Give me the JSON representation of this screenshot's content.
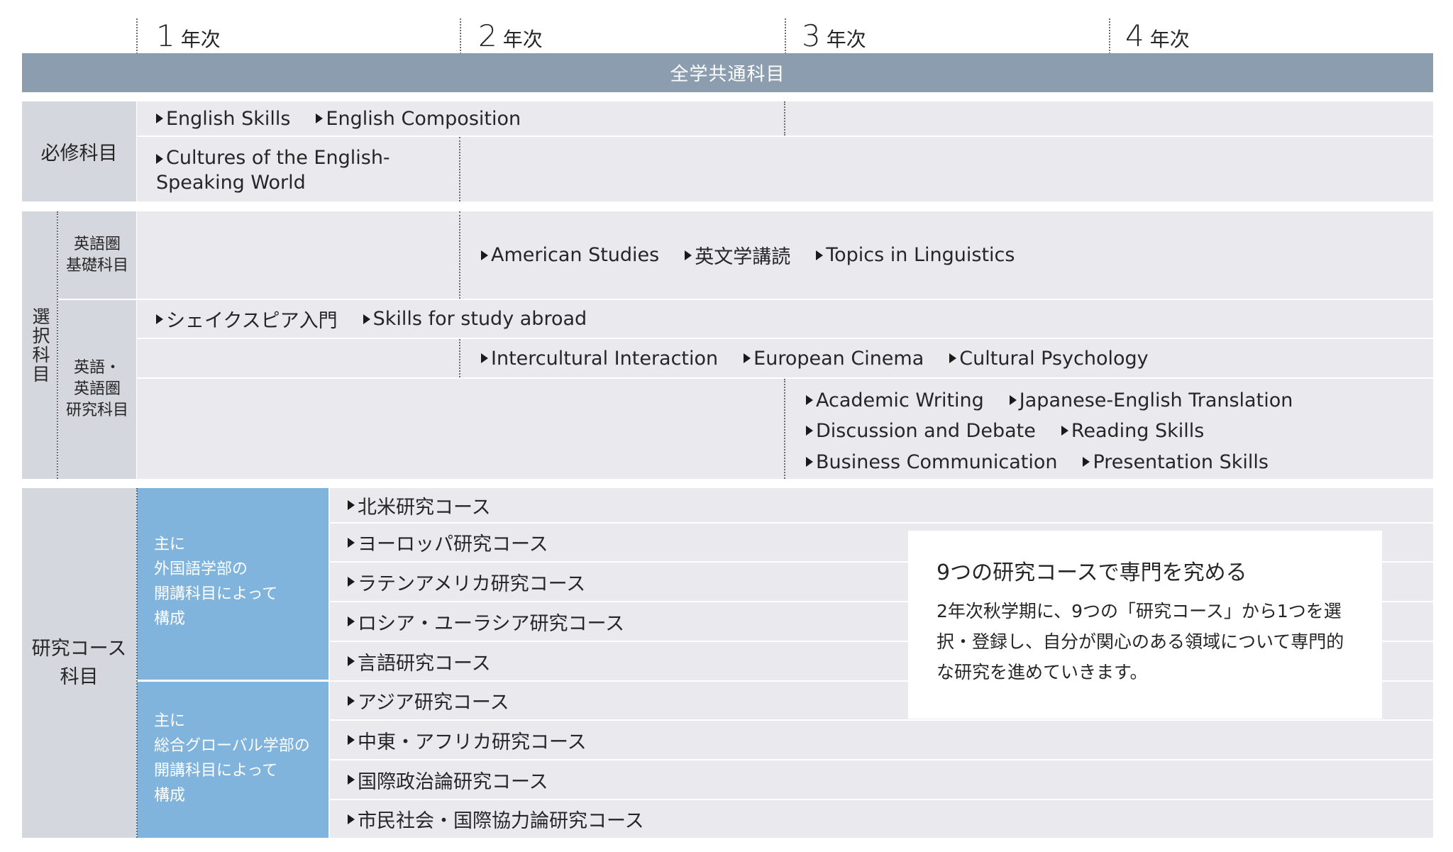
{
  "years": [
    {
      "num": "1",
      "suffix": "年次"
    },
    {
      "num": "2",
      "suffix": "年次"
    },
    {
      "num": "3",
      "suffix": "年次"
    },
    {
      "num": "4",
      "suffix": "年次"
    }
  ],
  "banner": "全学共通科目",
  "required": {
    "label": "必修科目",
    "row1": [
      "English Skills",
      "English Composition"
    ],
    "row2": "Cultures of the English-\nSpeaking World"
  },
  "elective": {
    "label": "選択科目",
    "basic_label": "英語圏\n基礎科目",
    "basic_items": [
      "American Studies",
      "英文学講読",
      "Topics in Linguistics"
    ],
    "research_label": "英語・\n英語圏\n研究科目",
    "row_a": [
      "シェイクスピア入門",
      "Skills for study abroad"
    ],
    "row_b": [
      "Intercultural Interaction",
      "European Cinema",
      "Cultural Psychology"
    ],
    "row_c1": [
      "Academic Writing",
      "Japanese-English Translation"
    ],
    "row_c2": [
      "Discussion and Debate",
      "Reading Skills"
    ],
    "row_c3": [
      "Business Communication",
      "Presentation Skills"
    ]
  },
  "courses": {
    "label": "研究コース\n科目",
    "group1": "主に\n外国語学部の\n開講科目によって\n構成",
    "group2": "主に\n総合グローバル学部の\n開講科目によって\n構成",
    "items": [
      "北米研究コース",
      "ヨーロッパ研究コース",
      "ラテンアメリカ研究コース",
      "ロシア・ユーラシア研究コース",
      "言語研究コース",
      "アジア研究コース",
      "中東・アフリカ研究コース",
      "国際政治論研究コース",
      "市民社会・国際協力論研究コース"
    ]
  },
  "callout": {
    "title": "9つの研究コースで専門を究める",
    "body": "2年次秋学期に、9つの「研究コース」から1つを選択・登録し、自分が関心のある領域について専門的な研究を進めていきます。"
  }
}
